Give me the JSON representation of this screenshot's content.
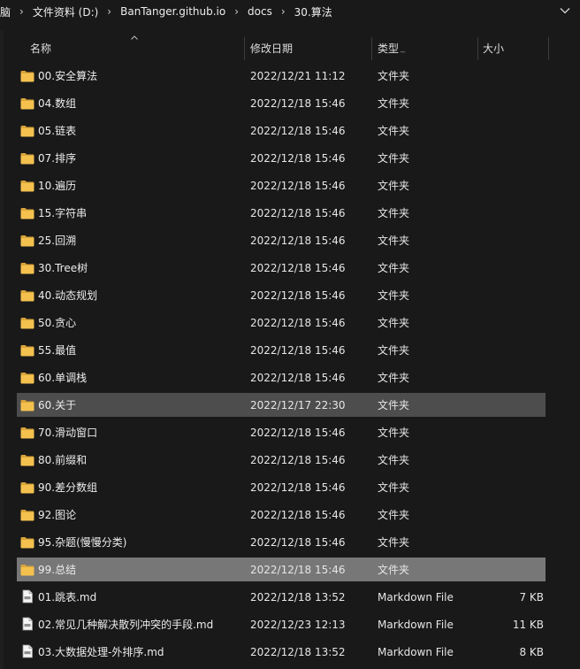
{
  "breadcrumb": {
    "items": [
      "脑",
      "文件资料 (D:)",
      "BanTanger.github.io",
      "docs",
      "30.算法"
    ]
  },
  "columns": {
    "name": "名称",
    "date": "修改日期",
    "type": "类型",
    "size": "大小"
  },
  "files": [
    {
      "name": "00.安全算法",
      "date": "2022/12/21 11:12",
      "type": "文件夹",
      "size": "",
      "icon": "folder-icon",
      "state": ""
    },
    {
      "name": "04.数组",
      "date": "2022/12/18 15:46",
      "type": "文件夹",
      "size": "",
      "icon": "folder-icon",
      "state": ""
    },
    {
      "name": "05.链表",
      "date": "2022/12/18 15:46",
      "type": "文件夹",
      "size": "",
      "icon": "folder-icon",
      "state": ""
    },
    {
      "name": "07.排序",
      "date": "2022/12/18 15:46",
      "type": "文件夹",
      "size": "",
      "icon": "folder-icon",
      "state": ""
    },
    {
      "name": "10.遍历",
      "date": "2022/12/18 15:46",
      "type": "文件夹",
      "size": "",
      "icon": "folder-icon",
      "state": ""
    },
    {
      "name": "15.字符串",
      "date": "2022/12/18 15:46",
      "type": "文件夹",
      "size": "",
      "icon": "folder-icon",
      "state": ""
    },
    {
      "name": "25.回溯",
      "date": "2022/12/18 15:46",
      "type": "文件夹",
      "size": "",
      "icon": "folder-icon",
      "state": ""
    },
    {
      "name": "30.Tree树",
      "date": "2022/12/18 15:46",
      "type": "文件夹",
      "size": "",
      "icon": "folder-icon",
      "state": ""
    },
    {
      "name": "40.动态规划",
      "date": "2022/12/18 15:46",
      "type": "文件夹",
      "size": "",
      "icon": "folder-icon",
      "state": ""
    },
    {
      "name": "50.贪心",
      "date": "2022/12/18 15:46",
      "type": "文件夹",
      "size": "",
      "icon": "folder-icon",
      "state": ""
    },
    {
      "name": "55.最值",
      "date": "2022/12/18 15:46",
      "type": "文件夹",
      "size": "",
      "icon": "folder-icon",
      "state": ""
    },
    {
      "name": "60.单调栈",
      "date": "2022/12/18 15:46",
      "type": "文件夹",
      "size": "",
      "icon": "folder-icon",
      "state": ""
    },
    {
      "name": "60.关于",
      "date": "2022/12/17 22:30",
      "type": "文件夹",
      "size": "",
      "icon": "folder-icon",
      "state": "selected"
    },
    {
      "name": "70.滑动窗口",
      "date": "2022/12/18 15:46",
      "type": "文件夹",
      "size": "",
      "icon": "folder-icon",
      "state": ""
    },
    {
      "name": "80.前缀和",
      "date": "2022/12/18 15:46",
      "type": "文件夹",
      "size": "",
      "icon": "folder-icon",
      "state": ""
    },
    {
      "name": "90.差分数组",
      "date": "2022/12/18 15:46",
      "type": "文件夹",
      "size": "",
      "icon": "folder-icon",
      "state": ""
    },
    {
      "name": "92.图论",
      "date": "2022/12/18 15:46",
      "type": "文件夹",
      "size": "",
      "icon": "folder-icon",
      "state": ""
    },
    {
      "name": "95.杂题(慢慢分类)",
      "date": "2022/12/18 15:46",
      "type": "文件夹",
      "size": "",
      "icon": "folder-icon",
      "state": ""
    },
    {
      "name": "99.总结",
      "date": "2022/12/18 15:46",
      "type": "文件夹",
      "size": "",
      "icon": "folder-icon",
      "state": "hover"
    },
    {
      "name": "01.跳表.md",
      "date": "2022/12/18 13:52",
      "type": "Markdown File",
      "size": "7 KB",
      "icon": "markdown-file-icon",
      "state": ""
    },
    {
      "name": "02.常见几种解决散列冲突的手段.md",
      "date": "2022/12/23 12:13",
      "type": "Markdown File",
      "size": "11 KB",
      "icon": "markdown-file-icon",
      "state": ""
    },
    {
      "name": "03.大数据处理-外排序.md",
      "date": "2022/12/18 13:52",
      "type": "Markdown File",
      "size": "8 KB",
      "icon": "markdown-file-icon",
      "state": ""
    }
  ],
  "colors": {
    "background": "#191919",
    "selected_row": "#4d4d4d",
    "hover_row": "#777777",
    "folder": "#f4c14f"
  }
}
